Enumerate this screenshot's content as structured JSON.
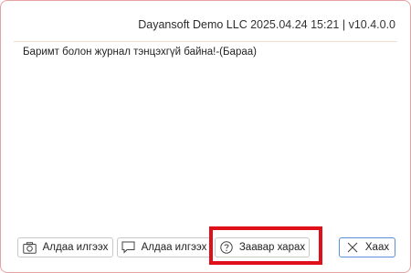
{
  "header": {
    "company": "Dayansoft Demo LLC",
    "datetime_version": "2025.04.24 15:21 | v10.4.0.0"
  },
  "message": "Баримт болон журнал тэнцэхгүй байна!-(Бараа)",
  "buttons": {
    "screenshot_error": {
      "label": "Алдаа илгээх",
      "icon": "camera-icon"
    },
    "send_error": {
      "label": "Алдаа илгээх",
      "icon": "comment-icon"
    },
    "help": {
      "label": "Заавар харах",
      "icon": "question-circle-icon"
    },
    "close": {
      "label": "Хаах",
      "icon": "close-icon"
    }
  },
  "colors": {
    "dialog_border": "#e8a1a1",
    "highlight": "#e0101a",
    "close_border": "#5a8ed6"
  }
}
